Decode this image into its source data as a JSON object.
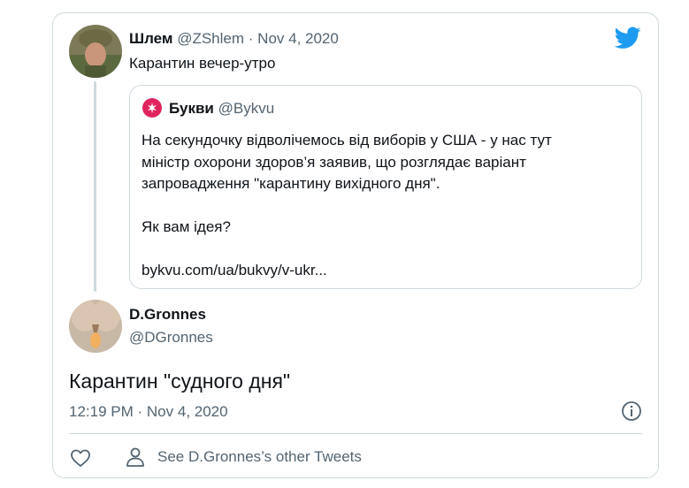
{
  "parent_tweet": {
    "name": "Шлем",
    "handle": "@ZShlem",
    "separator": "·",
    "date": "Nov 4, 2020",
    "text": "Карантин вечер-утро"
  },
  "quoted_tweet": {
    "name": "Букви",
    "handle": "@Bykvu",
    "lines": [
      "На секундочку відволічемось від виборів у США - у нас тут",
      "міністр охорони здоров’я заявив, що розглядає варіант",
      "запровадження \"карантину вихідного дня\"."
    ],
    "question": "Як вам ідея?",
    "link": "bykvu.com/ua/bukvy/v-ukr..."
  },
  "main_tweet": {
    "name": "D.Gronnes",
    "handle": "@DGronnes",
    "text": "Карантин \"судного дня\"",
    "time": "12:19 PM",
    "separator": "·",
    "date": "Nov 4, 2020"
  },
  "actions": {
    "see_more": "See D.Gronnes’s other Tweets"
  },
  "colors": {
    "twitter_blue": "#1d9bf0",
    "muted_text": "#536471",
    "border": "#cfd9de",
    "bykvu_red": "#e0245e"
  },
  "icons": [
    "twitter-logo-icon",
    "info-icon",
    "heart-icon",
    "person-icon"
  ]
}
